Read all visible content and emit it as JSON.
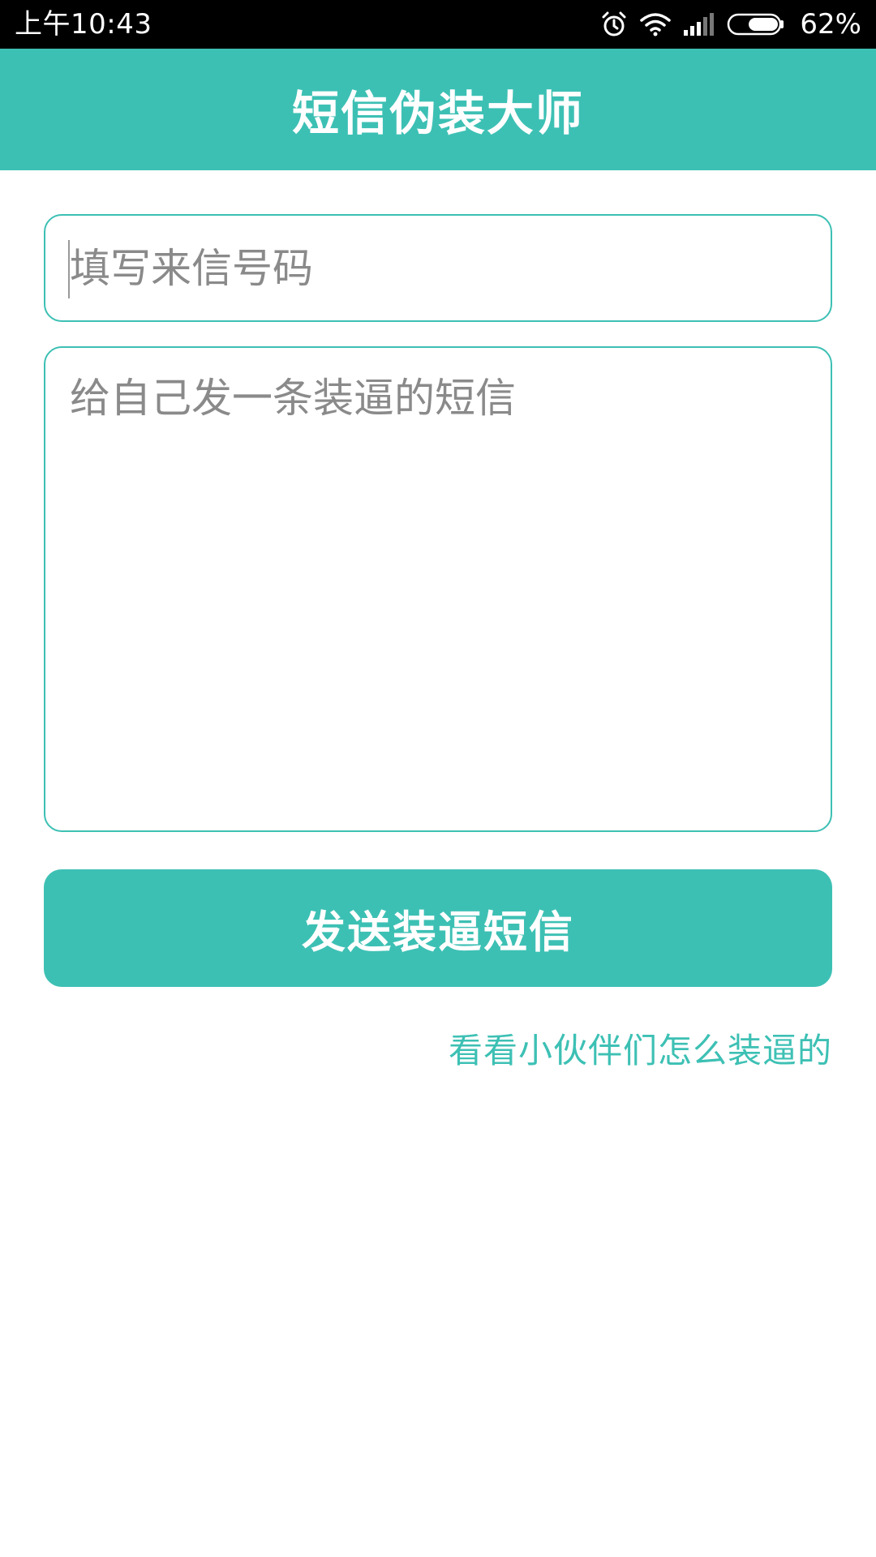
{
  "status_bar": {
    "time": "上午10:43",
    "battery_percent": "62%",
    "battery_level": 0.62,
    "icons": [
      "alarm-icon",
      "wifi-icon",
      "signal-icon",
      "battery-icon"
    ]
  },
  "app_bar": {
    "title": "短信伪装大师"
  },
  "form": {
    "phone_placeholder": "填写来信号码",
    "phone_value": "",
    "message_placeholder": "给自己发一条装逼的短信",
    "message_value": "",
    "send_label": "发送装逼短信"
  },
  "link": {
    "label": "看看小伙伴们怎么装逼的"
  },
  "colors": {
    "accent": "#3dc0b4",
    "status_bar": "#000000",
    "placeholder": "#8a8a8a",
    "background": "#ffffff"
  }
}
